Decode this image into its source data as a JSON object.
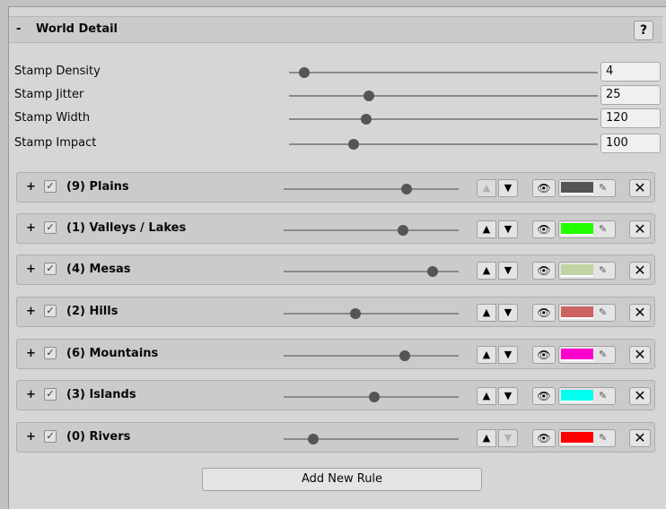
{
  "header": {
    "toggle": "-",
    "title": "World Detail",
    "help_label": "?"
  },
  "settings": [
    {
      "label": "Stamp Density",
      "value": "4",
      "slider_fraction": 0.05
    },
    {
      "label": "Stamp Jitter",
      "value": "25",
      "slider_fraction": 0.26
    },
    {
      "label": "Stamp Width",
      "value": "120",
      "slider_fraction": 0.25
    },
    {
      "label": "Stamp Impact",
      "value": "100",
      "slider_fraction": 0.21
    }
  ],
  "rules": [
    {
      "expand": "+",
      "check": "✓",
      "name": "(9) Plains",
      "color": "#555555",
      "slider_fraction": 0.7,
      "up_enabled": false,
      "down_enabled": true
    },
    {
      "expand": "+",
      "check": "✓",
      "name": "(1) Valleys / Lakes",
      "color": "#22ff00",
      "slider_fraction": 0.68,
      "up_enabled": true,
      "down_enabled": true
    },
    {
      "expand": "+",
      "check": "✓",
      "name": "(4) Mesas",
      "color": "#c3d3a4",
      "slider_fraction": 0.85,
      "up_enabled": true,
      "down_enabled": true
    },
    {
      "expand": "+",
      "check": "✓",
      "name": "(2) Hills",
      "color": "#cc6361",
      "slider_fraction": 0.41,
      "up_enabled": true,
      "down_enabled": true
    },
    {
      "expand": "+",
      "check": "✓",
      "name": "(6) Mountains",
      "color": "#ff00cc",
      "slider_fraction": 0.69,
      "up_enabled": true,
      "down_enabled": true
    },
    {
      "expand": "+",
      "check": "✓",
      "name": "(3) Islands",
      "color": "#00ffee",
      "slider_fraction": 0.52,
      "up_enabled": true,
      "down_enabled": true
    },
    {
      "expand": "+",
      "check": "✓",
      "name": "(0) Rivers",
      "color": "#ff0000",
      "slider_fraction": 0.17,
      "up_enabled": true,
      "down_enabled": false
    }
  ],
  "icons": {
    "up": "▲",
    "down": "▼",
    "eye": "👁",
    "picker": "✎",
    "delete": "✕",
    "eye_name": "eye-icon",
    "picker_name": "eyedropper-icon",
    "delete_name": "close-icon"
  },
  "add_rule_label": "Add New Rule"
}
